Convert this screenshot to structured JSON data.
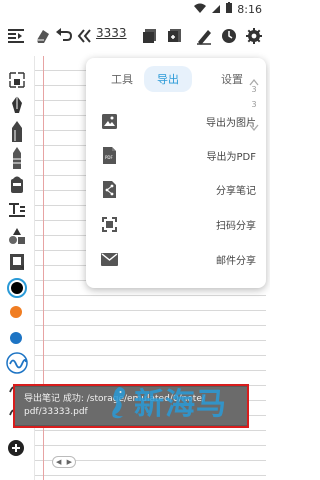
{
  "status": {
    "time": "8:16"
  },
  "toolbar": {
    "page_number": "3333"
  },
  "menu": {
    "tabs": [
      {
        "label": "工具"
      },
      {
        "label": "导出"
      },
      {
        "label": "设置"
      }
    ],
    "scroll_numbers": [
      "3",
      "3"
    ],
    "items": [
      {
        "label": "导出为图片",
        "icon": "image-icon"
      },
      {
        "label": "导出为PDF",
        "icon": "pdf-icon"
      },
      {
        "label": "分享笔记",
        "icon": "share-icon"
      },
      {
        "label": "扫码分享",
        "icon": "qr-scan-icon"
      },
      {
        "label": "邮件分享",
        "icon": "mail-icon"
      }
    ]
  },
  "toast": {
    "line1": "导出笔记 成功: /storage/emulated/0/note/",
    "line2": "pdf/33333.pdf"
  },
  "watermark": {
    "text": "新海马"
  },
  "colors": {
    "accent": "#2a9ad7",
    "orange": "#f07d22",
    "blue": "#1d74c4",
    "highlight": "#d81d1d"
  }
}
